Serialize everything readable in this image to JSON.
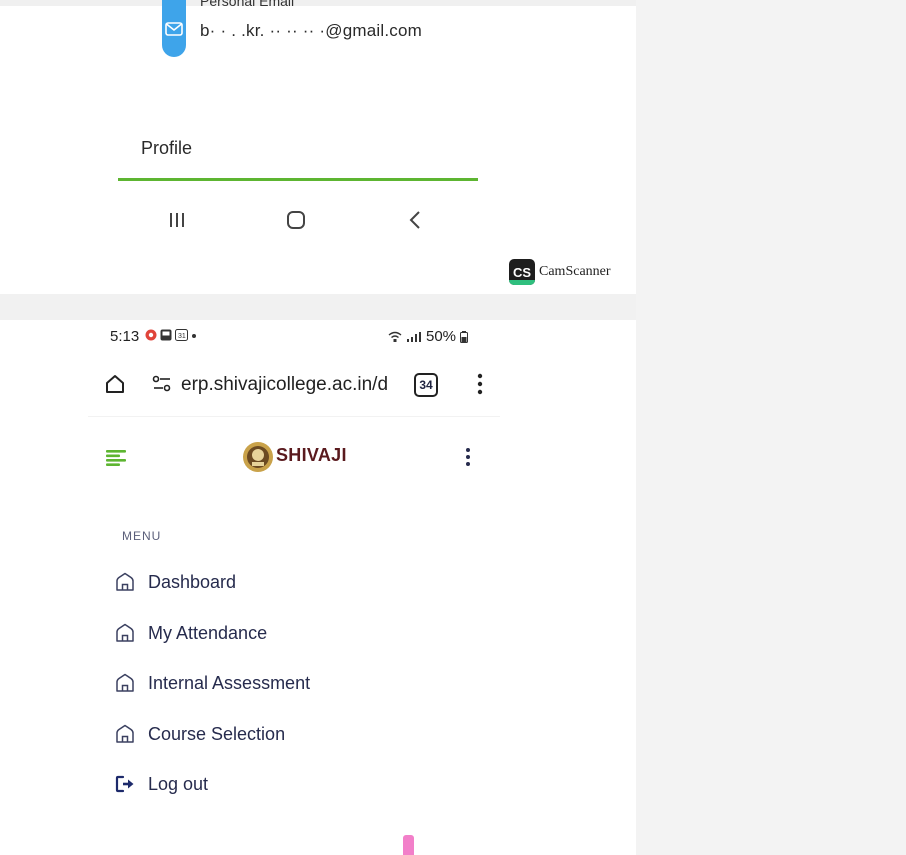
{
  "top_screen": {
    "email_label": "Personal Email",
    "email_value": "b· · . .kr. ·· ·· ·· ·@gmail.com",
    "profile_tab": "Profile",
    "nav_icons": [
      "recent-apps-icon",
      "home-icon",
      "back-icon"
    ],
    "scanner": {
      "badge": "CS",
      "name": "CamScanner"
    }
  },
  "status_bar": {
    "time": "5:13",
    "battery": "50%"
  },
  "browser": {
    "url": "erp.shivajicollege.ac.in/d",
    "tab_count": "34"
  },
  "header": {
    "brand": "SHIVAJI"
  },
  "menu": {
    "heading": "MENU",
    "items": [
      {
        "label": "Dashboard",
        "icon": "home-outline-icon"
      },
      {
        "label": "My Attendance",
        "icon": "home-outline-icon"
      },
      {
        "label": "Internal Assessment",
        "icon": "home-outline-icon"
      },
      {
        "label": "Course Selection",
        "icon": "home-outline-icon"
      },
      {
        "label": "Log out",
        "icon": "logout-icon"
      }
    ]
  },
  "colors": {
    "accent_green": "#5db531",
    "menu_text": "#262b4d",
    "brand": "#5a1a1e",
    "mail_badge": "#3ea4ea",
    "logout_icon": "#1d2a6b"
  }
}
